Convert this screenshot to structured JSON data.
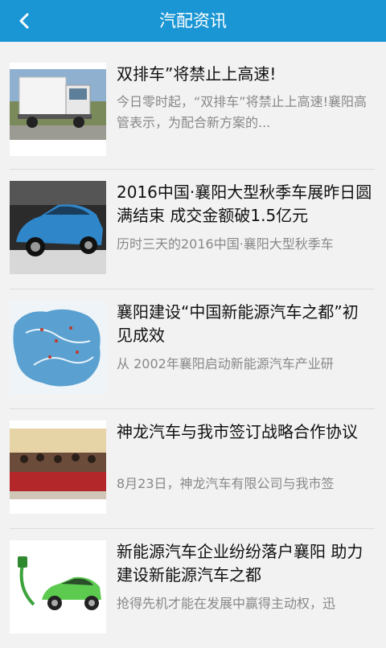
{
  "header": {
    "title": "汽配资讯",
    "back_icon": "chevron-left-icon",
    "background_color": "#1a96d4"
  },
  "news": [
    {
      "title": "双排车”将禁止上高速!",
      "summary": "今日零时起，“双排车”将禁止上高速!襄阳高管表示，为配合新方案的...",
      "thumb": "truck-photo"
    },
    {
      "title": "2016中国·襄阳大型秋季车展昨日圆满结束 成交金额破1.5亿元",
      "summary": "历时三天的2016中国·襄阳大型秋季车",
      "thumb": "blue-car-photo"
    },
    {
      "title": "襄阳建设“中国新能源汽车之都”初见成效",
      "summary": "从 2002年襄阳启动新能源汽车产业研",
      "thumb": "map-photo"
    },
    {
      "title": "神龙汽车与我市签订战略合作协议",
      "summary": "8月23日，神龙汽车有限公司与我市签",
      "thumb": "signing-ceremony-photo"
    },
    {
      "title": "新能源汽车企业纷纷落户襄阳 助力建设新能源汽车之都",
      "summary": "抢得先机才能在发展中赢得主动权，迅",
      "thumb": "green-electric-car-photo"
    }
  ]
}
